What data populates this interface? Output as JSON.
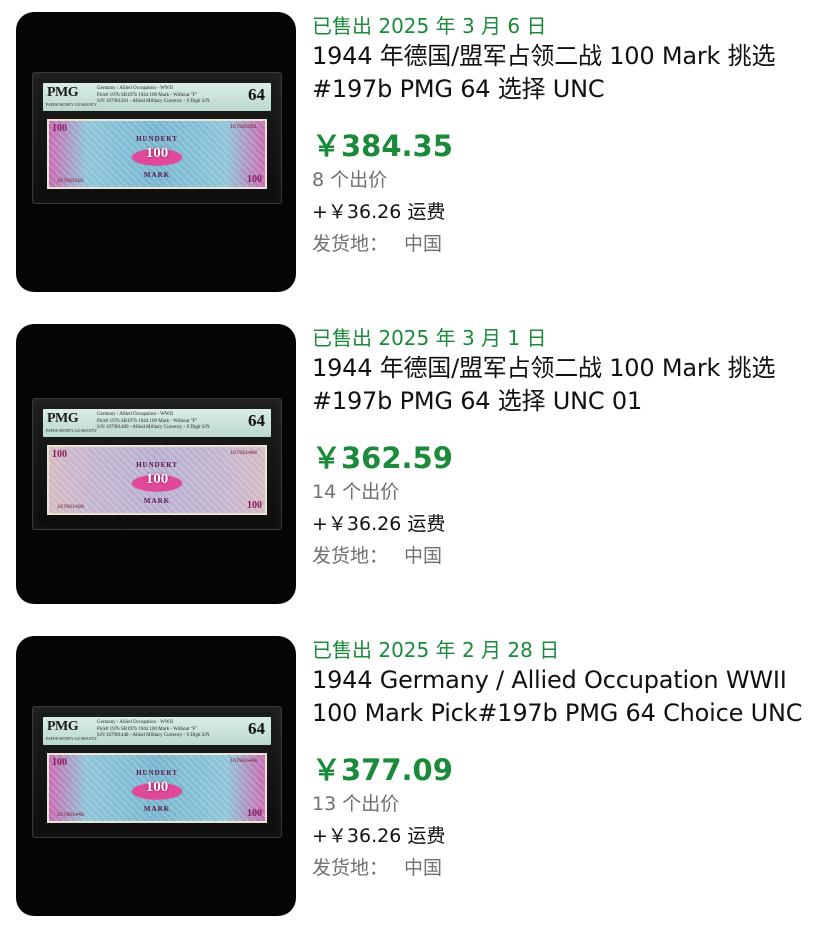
{
  "listings": [
    {
      "sold_text": "已售出 2025 年 3 月 6 日",
      "title": "1944 年德国/盟军占领二战 100 Mark 挑选 #197b PMG 64 选择 UNC",
      "price": "￥384.35",
      "bids": "8 个出价",
      "shipping": "+￥36.26 运费",
      "location_label": "发货地：",
      "location_value": "中国",
      "image": {
        "grader": "PMG",
        "label_desc": [
          "Germany / Allied Occupation - WWII",
          "Pick# 197b  SB197b   1944  100 Mark - Without \"F\"",
          "S/N 167901501 - Allied Military Currency - 9 Digit S/N"
        ],
        "grade": "64",
        "denomination": "100",
        "note_word_top": "HUNDERT",
        "note_word_bottom": "MARK"
      }
    },
    {
      "sold_text": "已售出 2025 年 3 月 1 日",
      "title": "1944 年德国/盟军占领二战 100 Mark 挑选 #197b PMG 64 选择 UNC 01",
      "price": "￥362.59",
      "bids": "14 个出价",
      "shipping": "+￥36.26 运费",
      "location_label": "发货地：",
      "location_value": "中国",
      "image": {
        "grader": "PMG",
        "label_desc": [
          "Germany / Allied Occupation - WWII",
          "Pick# 197b  SB197b   1944  100 Mark - Without \"F\"",
          "S/N 167901489 - Allied Military Currency - 9 Digit S/N"
        ],
        "grade": "64",
        "denomination": "100",
        "note_word_top": "HUNDERT",
        "note_word_bottom": "MARK"
      }
    },
    {
      "sold_text": "已售出 2025 年 2 月 28 日",
      "title": "1944 Germany / Allied Occupation WWII 100 Mark Pick#197b PMG 64 Choice UNC",
      "price": "￥377.09",
      "bids": "13 个出价",
      "shipping": "+￥36.26 运费",
      "location_label": "发货地：",
      "location_value": "中国",
      "image": {
        "grader": "PMG",
        "label_desc": [
          "Germany / Allied Occupation - WWII",
          "Pick# 197b  SB197b   1944  100 Mark - Without \"F\"",
          "S/N 167901448 - Allied Military Currency - 9 Digit S/N"
        ],
        "grade": "64",
        "denomination": "100",
        "note_word_top": "HUNDERT",
        "note_word_bottom": "MARK"
      }
    }
  ],
  "colors": {
    "sold_green": "#1b8a3a",
    "price_green": "#1b8a3a",
    "muted_gray": "#707070",
    "text_black": "#111111"
  }
}
